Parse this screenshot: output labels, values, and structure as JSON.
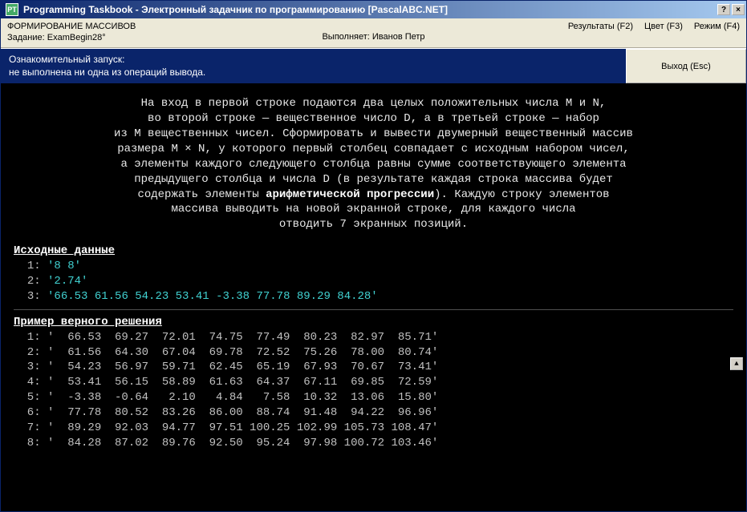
{
  "titlebar": {
    "icon_label": "PT",
    "title": "Programming Taskbook - Электронный задачник по программированию [PascalABC.NET]",
    "help": "?",
    "close": "×"
  },
  "toolbar": {
    "heading": "ФОРМИРОВАНИЕ МАССИВОВ",
    "task_label": "Задание: ExamBegin28°",
    "performer": "Выполняет: Иванов Петр",
    "results": "Результаты (F2)",
    "color": "Цвет (F3)",
    "mode": "Режим (F4)"
  },
  "status": {
    "line1": "Ознакомительный запуск:",
    "line2": "  не выполнена ни одна из операций вывода.",
    "exit": "Выход (Esc)"
  },
  "task_text": {
    "l1": "На вход в первой строке подаются два целых положительных числа M и N,",
    "l2": "во второй строке — вещественное число D, а в третьей строке — набор",
    "l3": "из M вещественных чисел. Сформировать и вывести двумерный вещественный массив",
    "l4": "размера M × N, у которого первый столбец совпадает с исходным набором чисел,",
    "l5": "а элементы каждого следующего столбца равны сумме соответствующего элемента",
    "l6a": "предыдущего столбца и числа D (в результате каждая строка массива будет",
    "l7a": "содержать элементы ",
    "l7b": "арифметической прогрессии",
    "l7c": "). Каждую строку элементов",
    "l8": "массива выводить на новой экранной строке, для каждого числа",
    "l9": "отводить 7 экранных позиций."
  },
  "input_header": "Исходные данные",
  "inputs": [
    {
      "idx": "1:",
      "val": "'8 8'"
    },
    {
      "idx": "2:",
      "val": "'2.74'"
    },
    {
      "idx": "3:",
      "val": "'66.53 61.56 54.23 53.41 -3.38 77.78 89.29 84.28'"
    }
  ],
  "example_header": "Пример верного решения",
  "example": [
    {
      "idx": "1:",
      "row": "'  66.53  69.27  72.01  74.75  77.49  80.23  82.97  85.71'"
    },
    {
      "idx": "2:",
      "row": "'  61.56  64.30  67.04  69.78  72.52  75.26  78.00  80.74'"
    },
    {
      "idx": "3:",
      "row": "'  54.23  56.97  59.71  62.45  65.19  67.93  70.67  73.41'"
    },
    {
      "idx": "4:",
      "row": "'  53.41  56.15  58.89  61.63  64.37  67.11  69.85  72.59'"
    },
    {
      "idx": "5:",
      "row": "'  -3.38  -0.64   2.10   4.84   7.58  10.32  13.06  15.80'"
    },
    {
      "idx": "6:",
      "row": "'  77.78  80.52  83.26  86.00  88.74  91.48  94.22  96.96'"
    },
    {
      "idx": "7:",
      "row": "'  89.29  92.03  94.77  97.51 100.25 102.99 105.73 108.47'"
    },
    {
      "idx": "8:",
      "row": "'  84.28  87.02  89.76  92.50  95.24  97.98 100.72 103.46'"
    }
  ],
  "scroll_up": "▲"
}
